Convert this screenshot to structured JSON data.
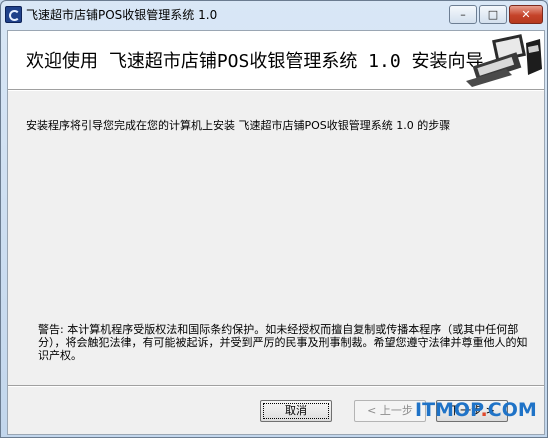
{
  "window": {
    "title": "飞速超市店铺POS收银管理系统 1.0",
    "controls": {
      "minimize": "–",
      "maximize": "□",
      "close": "✕"
    }
  },
  "header": {
    "title": "欢迎使用 飞速超市店铺POS收银管理系统 1.0 安装向导",
    "icon": "computer-icon"
  },
  "body": {
    "intro": "安装程序将引导您完成在您的计算机上安装 飞速超市店铺POS收银管理系统 1.0 的步骤",
    "warning": "警告: 本计算机程序受版权法和国际条约保护。如未经授权而擅自复制或传播本程序（或其中任何部分），将会触犯法律，有可能被起诉，并受到严厉的民事及刑事制裁。希望您遵守法律并尊重他人的知识产权。"
  },
  "buttons": {
    "cancel": "取消",
    "back": "< 上一步",
    "next": "下一步 >"
  },
  "watermark": {
    "prefix": "ITMOP",
    "dot": ".",
    "suffix": "COM"
  }
}
